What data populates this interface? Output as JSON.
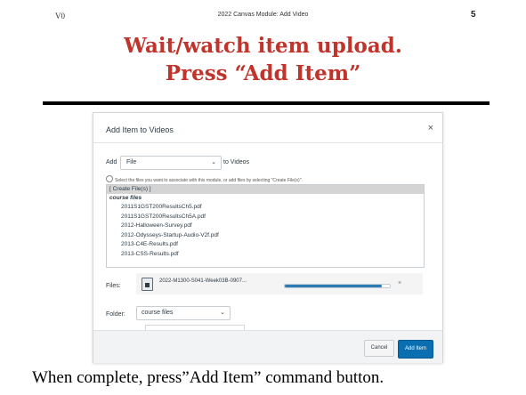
{
  "header": {
    "version": "V0",
    "module_title": "2022 Canvas Module: Add Video",
    "page_number": "5"
  },
  "slide_title": {
    "line1": "Wait/watch item upload.",
    "line2": "Press “Add Item”"
  },
  "dialog": {
    "title": "Add Item to Videos",
    "close_glyph": "×",
    "add_label": "Add",
    "add_type_value": "File",
    "to_label": "to Videos",
    "help_text": "Select the files you want to associate with this module, or add files by selecting \"Create File(s)\".",
    "file_list": {
      "create_option": "[ Create File(s) ]",
      "group_label": "course files",
      "items": [
        "2011S1GST200ResultsCh5.pdf",
        "2011S1GST200ResultsCh5A.pdf",
        "2012-Halloween-Survey.pdf",
        "2012-Odysseys-Startup-Audio-V2f.pdf",
        "2013-C4E-Results.pdf",
        "2013-CSS-Results.pdf"
      ]
    },
    "files_label": "Files:",
    "upload": {
      "file_name": "2022-M1300-S041-Week03B-0907...",
      "progress_fraction": 0.92,
      "remove_glyph": "×"
    },
    "folder_label": "Folder:",
    "folder_value": "course files",
    "cancel_label": "Cancel",
    "add_item_label": "Add Item"
  },
  "caption": "When complete, press”Add Item” command button.",
  "colors": {
    "title_red": "#c0342b",
    "primary_button": "#0a6fb0",
    "progress_fill": "#2b7ab3"
  }
}
